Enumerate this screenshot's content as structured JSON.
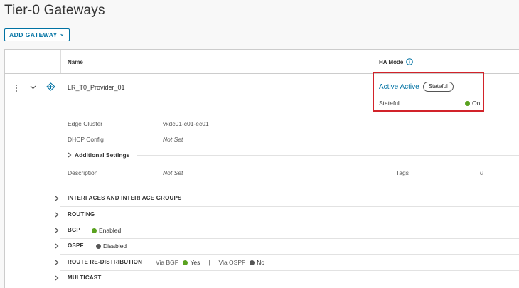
{
  "page": {
    "title": "Tier-0 Gateways"
  },
  "toolbar": {
    "add_gateway_label": "ADD GATEWAY",
    "add_gateway_caret": "⌄"
  },
  "table": {
    "header": {
      "name": "Name",
      "ha_mode": "HA Mode"
    },
    "row": {
      "name": "LR_T0_Provider_01",
      "ha_mode_value": "Active Active",
      "ha_badge": "Stateful",
      "stateful_label": "Stateful",
      "stateful_value": "On"
    },
    "details": {
      "edge_cluster_label": "Edge Cluster",
      "edge_cluster_value": "vxdc01-c01-ec01",
      "dhcp_label": "DHCP Config",
      "dhcp_value": "Not Set",
      "additional_settings": "Additional Settings",
      "description_label": "Description",
      "description_value": "Not Set",
      "tags_label": "Tags",
      "tags_value": "0"
    },
    "sections": [
      {
        "label": "INTERFACES AND INTERFACE GROUPS"
      },
      {
        "label": "ROUTING"
      },
      {
        "label": "BGP",
        "status": "Enabled"
      },
      {
        "label": "OSPF",
        "status": "Disabled"
      },
      {
        "label": "ROUTE RE-DISTRIBUTION",
        "via_bgp_label": "Via BGP",
        "via_bgp_value": "Yes",
        "separator": "|",
        "via_ospf_label": "Via OSPF",
        "via_ospf_value": "No"
      },
      {
        "label": "MULTICAST"
      }
    ]
  },
  "colors": {
    "accent": "#0072a3",
    "enabled": "#5aa220",
    "disabled": "#565656",
    "highlight": "#d2232a"
  },
  "icons": [
    "chevron-down-icon",
    "kebab-menu-icon",
    "gateway-icon",
    "info-icon",
    "chevron-right-icon"
  ]
}
